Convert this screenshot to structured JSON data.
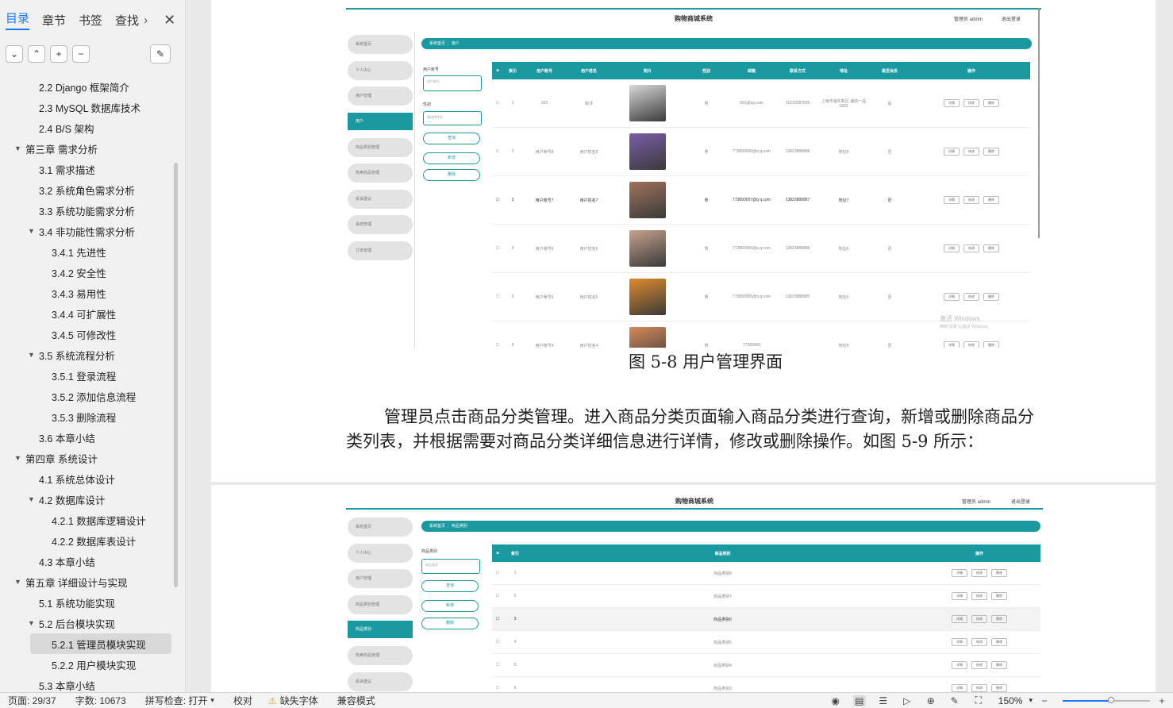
{
  "sidebar": {
    "tabs": [
      "目录",
      "章节",
      "书签",
      "查找"
    ],
    "toc": [
      {
        "label": "2.2 Django 框架简介",
        "level": 2
      },
      {
        "label": "2.3 MySQL 数据库技术",
        "level": 2
      },
      {
        "label": "2.4 B/S 架构",
        "level": 2
      },
      {
        "label": "第三章  需求分析",
        "level": 1,
        "expanded": true
      },
      {
        "label": "3.1 需求描述",
        "level": 2
      },
      {
        "label": "3.2 系统角色需求分析",
        "level": 2
      },
      {
        "label": "3.3 系统功能需求分析",
        "level": 2
      },
      {
        "label": "3.4 非功能性需求分析",
        "level": 2,
        "expanded": true
      },
      {
        "label": "3.4.1  先进性",
        "level": 3
      },
      {
        "label": "3.4.2 安全性",
        "level": 3
      },
      {
        "label": "3.4.3  易用性",
        "level": 3
      },
      {
        "label": "3.4.4 可扩展性",
        "level": 3
      },
      {
        "label": "3.4.5 可修改性",
        "level": 3
      },
      {
        "label": "3.5 系统流程分析",
        "level": 2,
        "expanded": true
      },
      {
        "label": "3.5.1 登录流程",
        "level": 3
      },
      {
        "label": "3.5.2 添加信息流程",
        "level": 3
      },
      {
        "label": "3.5.3 删除流程",
        "level": 3
      },
      {
        "label": "3.6 本章小结",
        "level": 2
      },
      {
        "label": "第四章  系统设计",
        "level": 1,
        "expanded": true
      },
      {
        "label": "4.1 系统总体设计",
        "level": 2
      },
      {
        "label": "4.2 数据库设计",
        "level": 2,
        "expanded": true
      },
      {
        "label": "4.2.1 数据库逻辑设计",
        "level": 3
      },
      {
        "label": "4.2.2 数据库表设计",
        "level": 3
      },
      {
        "label": "4.3 本章小结",
        "level": 2
      },
      {
        "label": "第五章  详细设计与实现",
        "level": 1,
        "expanded": true
      },
      {
        "label": "5.1 系统功能实现",
        "level": 2
      },
      {
        "label": "5.2 后台模块实现",
        "level": 2,
        "expanded": true
      },
      {
        "label": "5.2.1 管理员模块实现",
        "level": 3,
        "active": true
      },
      {
        "label": "5.2.2 用户模块实现",
        "level": 3
      },
      {
        "label": "5.3 本章小结",
        "level": 2
      }
    ]
  },
  "shot1": {
    "title": "购物商城系统",
    "admin": "管理员 admin",
    "logout": "退出登录",
    "breadcrumb": "系统首页 ⋮ 用户",
    "nav": [
      "系统首页",
      "个人中心",
      "用户管理",
      "用户",
      "商品类别管理",
      "热卖商品管理",
      "投诉建议",
      "系统管理",
      "订单管理"
    ],
    "filters": {
      "label1": "用户账号",
      "placeholder1": "用户账号",
      "label2": "性别",
      "placeholder2": "请选择性别"
    },
    "buttons": [
      "查询",
      "新增",
      "删除"
    ],
    "headers": [
      "索引",
      "用户账号",
      "用户姓名",
      "照片",
      "性别",
      "邮箱",
      "联系方式",
      "地址",
      "是否会员",
      "操作"
    ],
    "rows": [
      {
        "idx": "1",
        "account": "333",
        "name": "晓洋",
        "gender": "男",
        "email": "991@qq.com",
        "phone": "15219187555",
        "addr": "上海市浦东新区 浦前一品1802",
        "vip": "是",
        "photo": "#d9d9d9"
      },
      {
        "idx": "2",
        "account": "用户账号8",
        "name": "用户姓名8",
        "gender": "男",
        "email": "773890008@q q.com",
        "phone": "13823888888",
        "addr": "地址8",
        "vip": "否",
        "photo": "#7a5ea8"
      },
      {
        "idx": "3",
        "account": "用户账号7",
        "name": "用户姓名7",
        "gender": "男",
        "email": "773890007@q q.com",
        "phone": "13823888887",
        "addr": "地址7",
        "vip": "否",
        "photo": "#a0735a"
      },
      {
        "idx": "4",
        "account": "用户账号6",
        "name": "用户姓名6",
        "gender": "男",
        "email": "773890006@q q.com",
        "phone": "13823888886",
        "addr": "地址6",
        "vip": "否",
        "photo": "#c7a28c"
      },
      {
        "idx": "5",
        "account": "用户账号5",
        "name": "用户姓名5",
        "gender": "男",
        "email": "773890005@q q.com",
        "phone": "13823888885",
        "addr": "地址5",
        "vip": "否",
        "photo": "#e08a2c"
      },
      {
        "idx": "6",
        "account": "用户账号4",
        "name": "用户姓名4",
        "gender": "男",
        "email": "77389000",
        "phone": "",
        "addr": "地址4",
        "vip": "否",
        "photo": "#d88a5a"
      }
    ],
    "ops": [
      "详情",
      "修改",
      "删除"
    ],
    "watermark1": "激活 Windows",
    "watermark2": "转到\"设置\"以激活 Windows。"
  },
  "caption": "图 5-8 用户管理界面",
  "paragraph": "管理员点击商品分类管理。进入商品分类页面输入商品分类进行查询，新增或删除商品分类列表，并根据需要对商品分类详细信息进行详情，修改或删除操作。如图 5-9 所示：",
  "shot2": {
    "title": "购物商城系统",
    "admin": "管理员 admin",
    "logout": "退出登录",
    "breadcrumb": "系统首页 ⋮ 商品类别",
    "nav": [
      "系统首页",
      "个人中心",
      "用户管理",
      "商品类别管理",
      "商品类别",
      "热卖商品管理",
      "投诉建议"
    ],
    "filters": {
      "label1": "商品类别",
      "placeholder1": "商品类别"
    },
    "buttons": [
      "查询",
      "新增",
      "删除"
    ],
    "headers": [
      "索引",
      "商品类别",
      "操作"
    ],
    "rows": [
      {
        "idx": "1",
        "cat": "商品类别8"
      },
      {
        "idx": "2",
        "cat": "商品类别7"
      },
      {
        "idx": "3",
        "cat": "商品类别6"
      },
      {
        "idx": "4",
        "cat": "商品类别5"
      },
      {
        "idx": "5",
        "cat": "商品类别4"
      },
      {
        "idx": "6",
        "cat": "商品类别3"
      }
    ],
    "ops": [
      "详情",
      "修改",
      "删除"
    ]
  },
  "status": {
    "page": "页面: 29/37",
    "words": "字数: 10673",
    "spell": "拼写检查: 打开",
    "proof": "校对",
    "missing_font": "缺失字体",
    "compat": "兼容模式",
    "zoom": "150%",
    "zoom_level": 0.55
  },
  "colors": {
    "accent": "#1a9aa0",
    "link": "#1677ff"
  }
}
